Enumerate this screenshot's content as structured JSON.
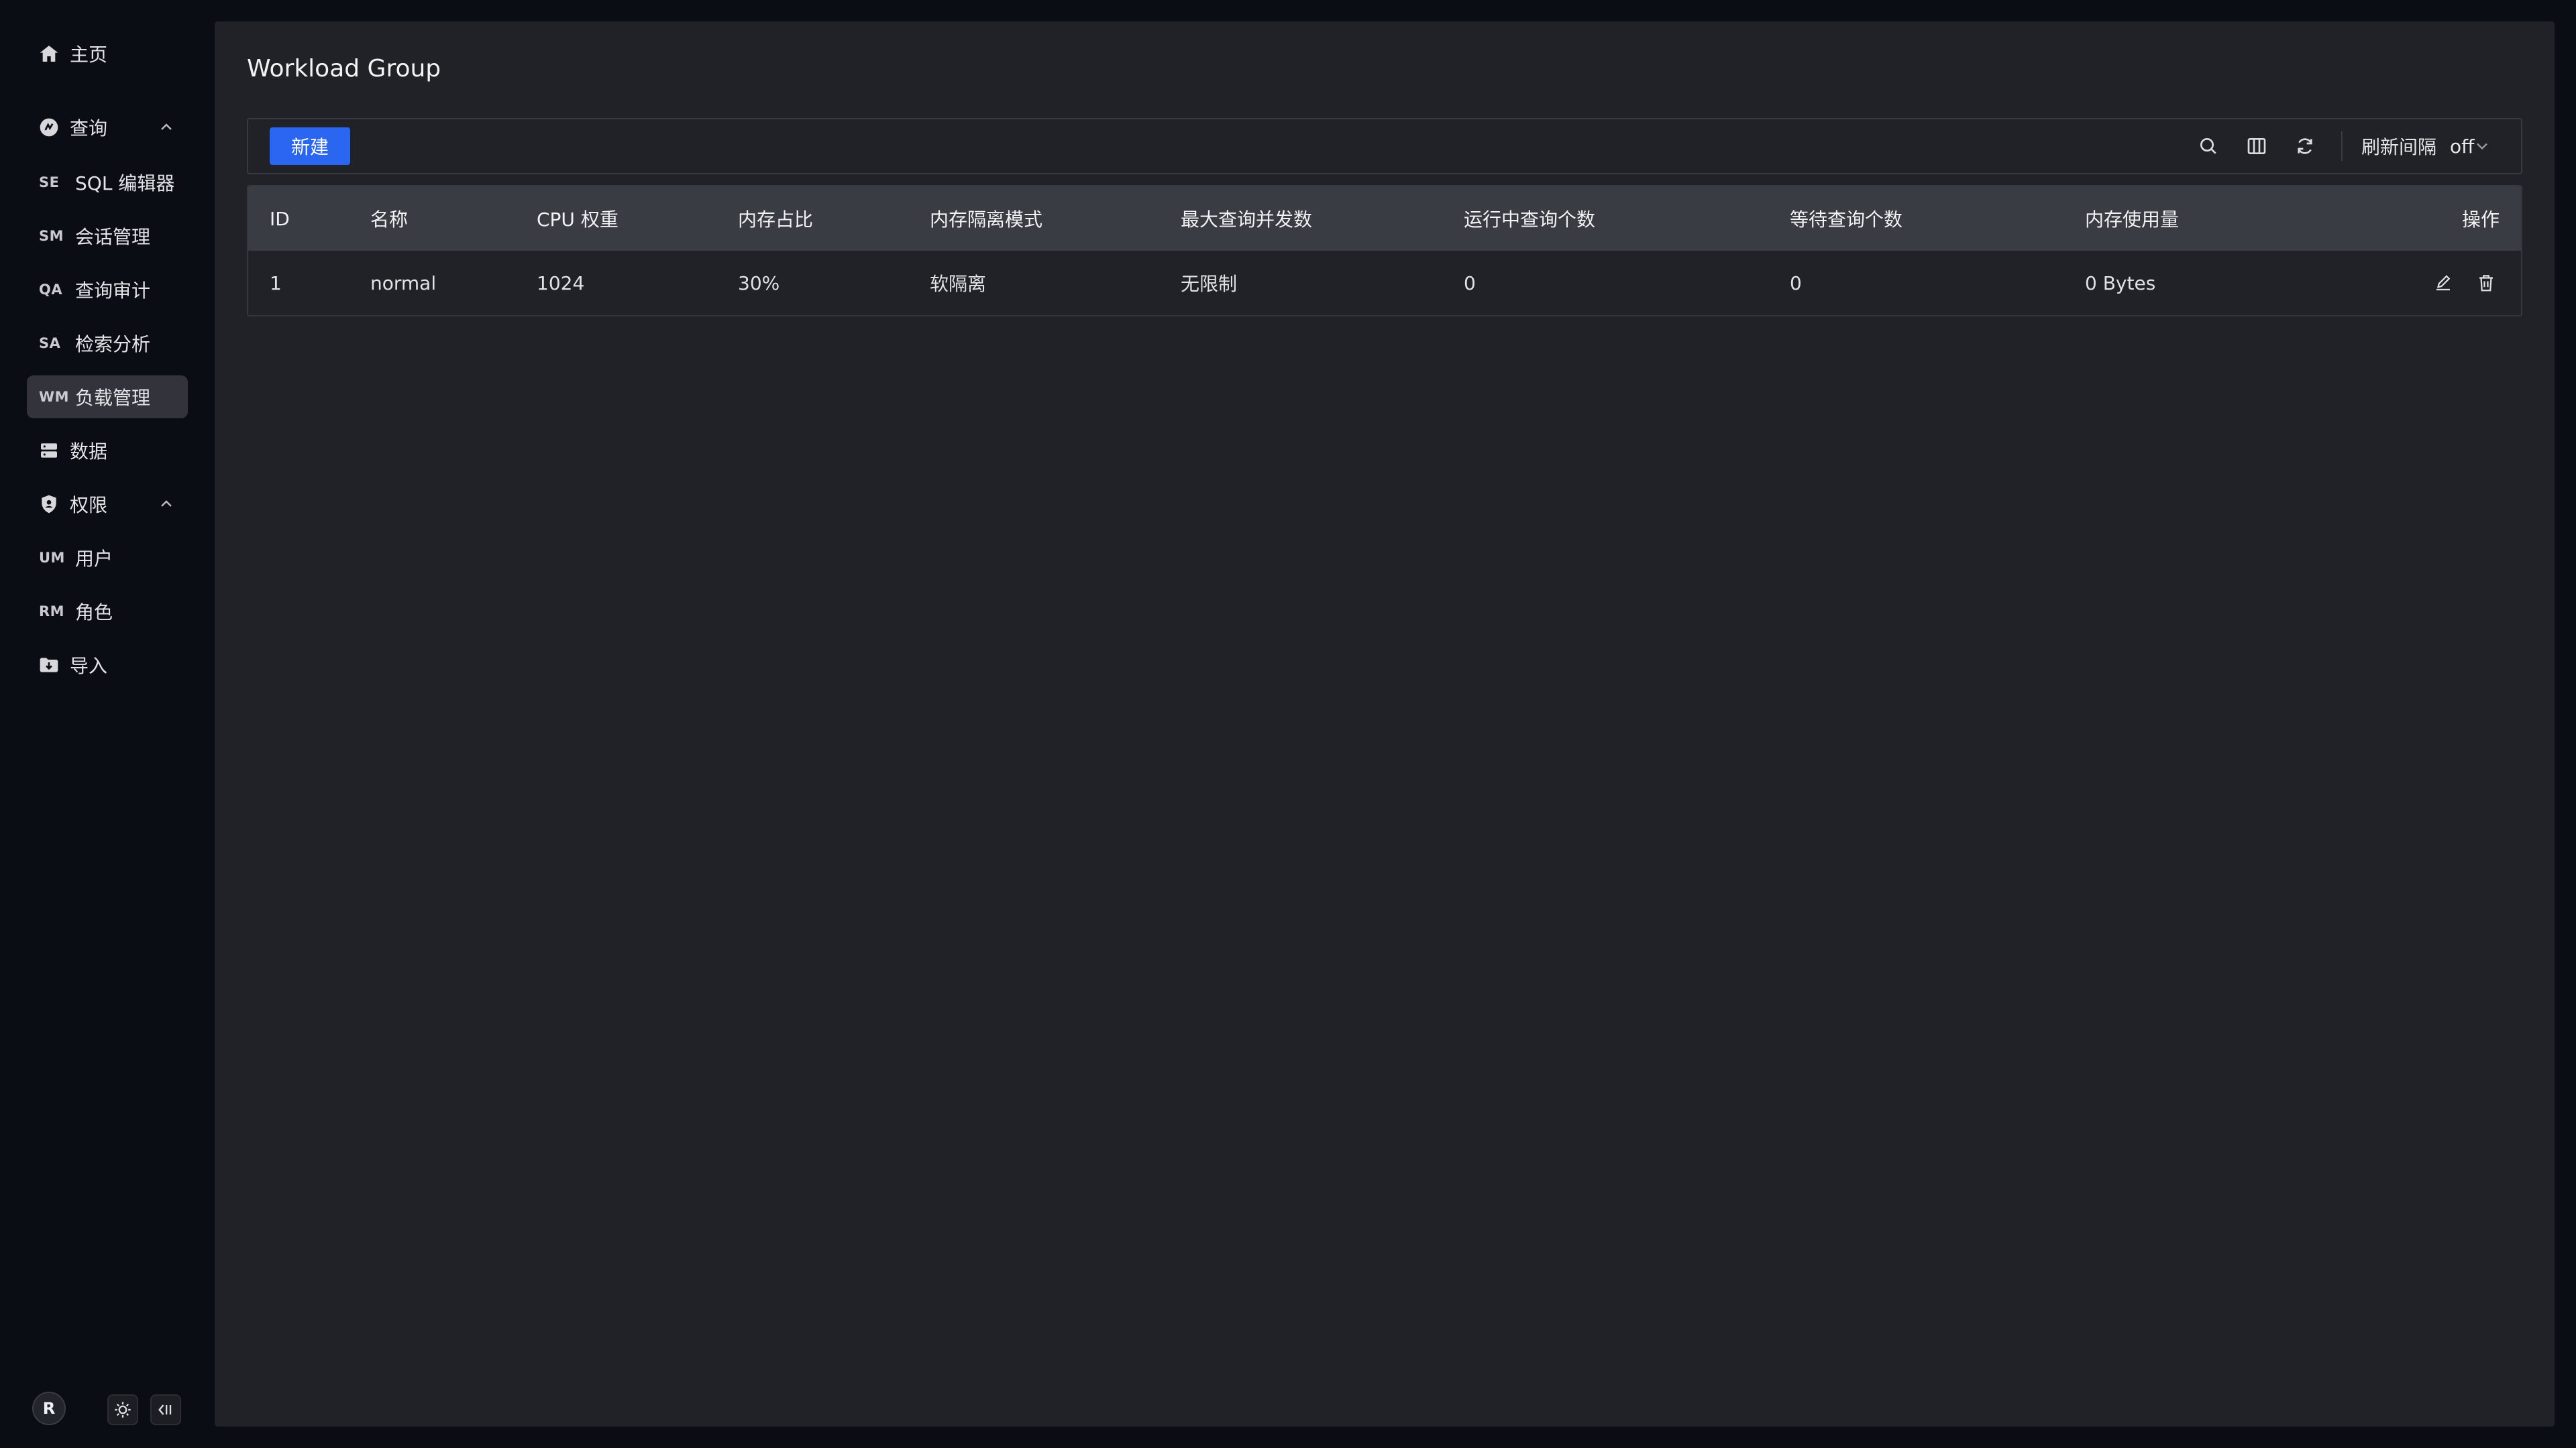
{
  "sidebar": {
    "home": {
      "label": "主页",
      "icon": "home-icon"
    },
    "query": {
      "label": "查询",
      "icon": "query-icon"
    },
    "query_items": [
      {
        "abbr": "SE",
        "label": "SQL 编辑器"
      },
      {
        "abbr": "SM",
        "label": "会话管理"
      },
      {
        "abbr": "QA",
        "label": "查询审计"
      },
      {
        "abbr": "SA",
        "label": "检索分析"
      },
      {
        "abbr": "WM",
        "label": "负载管理",
        "active": true
      }
    ],
    "data": {
      "label": "数据",
      "icon": "database-icon"
    },
    "permission": {
      "label": "权限",
      "icon": "shield-icon"
    },
    "permission_items": [
      {
        "abbr": "UM",
        "label": "用户"
      },
      {
        "abbr": "RM",
        "label": "角色"
      }
    ],
    "import": {
      "label": "导入",
      "icon": "folder-import-icon"
    },
    "avatar": "R"
  },
  "page": {
    "title": "Workload Group",
    "new_button": "新建",
    "refresh_label": "刷新间隔",
    "refresh_value": "off"
  },
  "table": {
    "headers": [
      "ID",
      "名称",
      "CPU 权重",
      "内存占比",
      "内存隔离模式",
      "最大查询并发数",
      "运行中查询个数",
      "等待查询个数",
      "内存使用量",
      "操作"
    ],
    "rows": [
      [
        "1",
        "normal",
        "1024",
        "30%",
        "软隔离",
        "无限制",
        "0",
        "0",
        "0 Bytes"
      ]
    ]
  },
  "colors": {
    "accent": "#2a66f0",
    "panel": "#202227",
    "page_bg": "#0b0d14",
    "header_bg": "#3a3c43",
    "active_nav": "#33343b"
  }
}
